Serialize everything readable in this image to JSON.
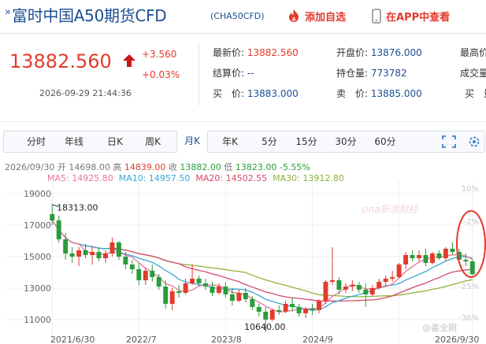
{
  "header": {
    "chevron": "»",
    "title": "富时中国A50期货CFD",
    "code": "(CHA50CFD)",
    "add_favorite": "添加自选",
    "view_in_app": "在APP中查看"
  },
  "quote": {
    "price": "13882.560",
    "change": "+3.560",
    "change_pct": "+0.03%",
    "datetime": "2026-09-29 21:44:36",
    "fields": [
      {
        "label": "最新价:",
        "value": "13882.560",
        "color": "red"
      },
      {
        "label": "结算价:",
        "value": "--",
        "color": "blue"
      },
      {
        "label": "买　价:",
        "value": "13883.000",
        "color": "blue"
      },
      {
        "label": "开盘价:",
        "value": "13876.000",
        "color": "blue"
      },
      {
        "label": "持仓量:",
        "value": "773782",
        "color": "blue"
      },
      {
        "label": "卖　价:",
        "value": "13885.000",
        "color": "blue"
      },
      {
        "label": "最高价",
        "value": "",
        "color": "blue"
      },
      {
        "label": "成交量",
        "value": "",
        "color": "blue"
      },
      {
        "label": "买　量",
        "value": "",
        "color": "blue"
      }
    ]
  },
  "tabs": [
    "分时",
    "年线",
    "日K",
    "周K",
    "月K",
    "年K",
    "5分",
    "15分",
    "30分",
    "60分"
  ],
  "active_tab": "月K",
  "chart_info": {
    "date": "2026/09/30",
    "open_label": "开",
    "open": "14698.00",
    "high_label": "高",
    "high": "14839.00",
    "close_label": "收",
    "close": "13882.00",
    "low_label": "低",
    "low": "13823.00",
    "change_pct": "-5.55%",
    "ma5": "MA5: 14925.80",
    "ma10": "MA10: 14957.50",
    "ma20": "MA20: 14502.55",
    "ma30": "MA30: 13912.80"
  },
  "chart_data": {
    "type": "candlestick",
    "y_ticks": [
      "19000",
      "17000",
      "15000",
      "13000",
      "11000"
    ],
    "y_right_ticks": [
      "10%",
      "-2%",
      "-25%",
      "-36%"
    ],
    "x_ticks": [
      "2021/6/30",
      "2022/7",
      "2023/8",
      "2024/9",
      "2026/9/30"
    ],
    "ylim": [
      10000,
      19400
    ],
    "max_label": "18313.00",
    "min_label": "10640.00",
    "watermark": "sina新浪财经",
    "credit": "@姜全刚",
    "colors": {
      "up": "#e23b2c",
      "down": "#2a9c3b",
      "ma5": "#e8769a",
      "ma10": "#3ba8d8",
      "ma20": "#d64a6a",
      "ma30": "#8fb23a"
    },
    "candles": [
      [
        17700,
        18313,
        17000,
        17300
      ],
      [
        17300,
        17600,
        15900,
        16100
      ],
      [
        16100,
        16500,
        14800,
        15200
      ],
      [
        15200,
        15600,
        14600,
        15000
      ],
      [
        15000,
        15600,
        14400,
        15400
      ],
      [
        15400,
        15800,
        14900,
        15100
      ],
      [
        15100,
        15700,
        14500,
        15300
      ],
      [
        15300,
        15600,
        14700,
        14900
      ],
      [
        14900,
        15400,
        14600,
        15200
      ],
      [
        15200,
        16200,
        15000,
        15900
      ],
      [
        15900,
        16000,
        14800,
        15000
      ],
      [
        15000,
        15300,
        14200,
        14500
      ],
      [
        14500,
        14800,
        13900,
        14200
      ],
      [
        14200,
        14600,
        13200,
        13500
      ],
      [
        13500,
        14300,
        13200,
        14100
      ],
      [
        14100,
        14500,
        13400,
        13700
      ],
      [
        13700,
        13900,
        12900,
        13100
      ],
      [
        13100,
        13500,
        11700,
        12000
      ],
      [
        12000,
        13000,
        11600,
        12800
      ],
      [
        12800,
        13200,
        12400,
        12700
      ],
      [
        12700,
        13600,
        12600,
        13300
      ],
      [
        13300,
        14500,
        13200,
        13600
      ],
      [
        13600,
        13800,
        13100,
        13300
      ],
      [
        13300,
        13600,
        12900,
        13100
      ],
      [
        13100,
        13400,
        12500,
        12700
      ],
      [
        12700,
        13300,
        12600,
        13100
      ],
      [
        13100,
        13400,
        12400,
        12600
      ],
      [
        12600,
        13000,
        11900,
        12200
      ],
      [
        12200,
        12900,
        12100,
        12700
      ],
      [
        12700,
        13000,
        12100,
        12300
      ],
      [
        12300,
        12500,
        11600,
        11800
      ],
      [
        11800,
        12000,
        11200,
        11500
      ],
      [
        11500,
        11800,
        10640,
        11000
      ],
      [
        11000,
        11700,
        10900,
        11600
      ],
      [
        11600,
        11900,
        11300,
        11500
      ],
      [
        11500,
        12200,
        11400,
        12000
      ],
      [
        12000,
        12400,
        11500,
        11800
      ],
      [
        11800,
        12000,
        11200,
        11400
      ],
      [
        11400,
        11800,
        11100,
        11700
      ],
      [
        11700,
        12000,
        11300,
        11600
      ],
      [
        11600,
        12300,
        11400,
        12200
      ],
      [
        12200,
        13500,
        12000,
        13400
      ],
      [
        13400,
        15600,
        13200,
        13500
      ],
      [
        13500,
        13700,
        12600,
        12900
      ],
      [
        12900,
        13300,
        12700,
        13100
      ],
      [
        13100,
        13500,
        12800,
        13200
      ],
      [
        13200,
        13400,
        12700,
        12900
      ],
      [
        12900,
        13300,
        11800,
        12600
      ],
      [
        12600,
        13200,
        12500,
        13000
      ],
      [
        13000,
        13600,
        12900,
        13400
      ],
      [
        13400,
        13800,
        13200,
        13600
      ],
      [
        13600,
        14100,
        13400,
        13700
      ],
      [
        13700,
        14600,
        13600,
        14500
      ],
      [
        14500,
        15300,
        14200,
        15100
      ],
      [
        15100,
        15400,
        14700,
        14900
      ],
      [
        14900,
        15400,
        14700,
        15100
      ],
      [
        15100,
        15500,
        14400,
        14600
      ],
      [
        14600,
        15300,
        14500,
        15200
      ],
      [
        15200,
        15400,
        14800,
        14900
      ],
      [
        14900,
        15600,
        14700,
        15500
      ],
      [
        15500,
        15900,
        15100,
        15300
      ],
      [
        15300,
        15500,
        14600,
        14800
      ],
      [
        14800,
        15200,
        14400,
        14700
      ],
      [
        14698,
        14839,
        13823,
        13882
      ]
    ]
  }
}
